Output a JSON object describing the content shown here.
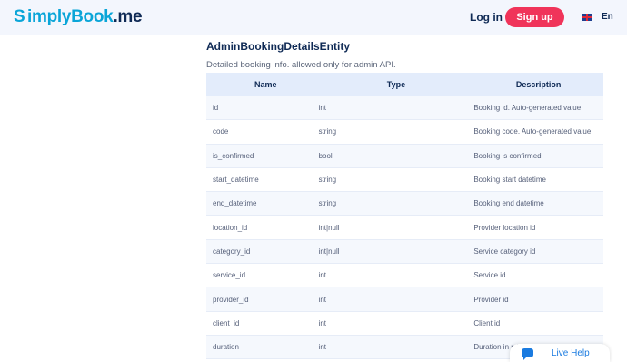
{
  "header": {
    "logo_initial": "S",
    "logo_text": "implyBook",
    "logo_suffix": ".me",
    "login_label": "Log in",
    "signup_label": "Sign up",
    "lang_label": "En"
  },
  "main": {
    "title": "AdminBookingDetailsEntity",
    "subtitle": "Detailed booking info. allowed only for admin API.",
    "columns": [
      "Name",
      "Type",
      "Description"
    ],
    "rows": [
      {
        "name": "id",
        "type": "int",
        "desc": "Booking id. Auto-generated value."
      },
      {
        "name": "code",
        "type": "string",
        "desc": "Booking code. Auto-generated value."
      },
      {
        "name": "is_confirmed",
        "type": "bool",
        "desc": "Booking is confirmed"
      },
      {
        "name": "start_datetime",
        "type": "string",
        "desc": "Booking start datetime"
      },
      {
        "name": "end_datetime",
        "type": "string",
        "desc": "Booking end datetime"
      },
      {
        "name": "location_id",
        "type": "int|null",
        "desc": "Provider location id"
      },
      {
        "name": "category_id",
        "type": "int|null",
        "desc": "Service category id"
      },
      {
        "name": "service_id",
        "type": "int",
        "desc": "Service id"
      },
      {
        "name": "provider_id",
        "type": "int",
        "desc": "Provider id"
      },
      {
        "name": "client_id",
        "type": "int",
        "desc": "Client id"
      },
      {
        "name": "duration",
        "type": "int",
        "desc": "Duration in minutes"
      }
    ]
  },
  "live_help": {
    "label": "Live Help"
  },
  "colors": {
    "accent": "#0aa5d8",
    "signup": "#f0345a",
    "header_bg": "#f3f6fd",
    "table_head": "#e3ecfb"
  }
}
